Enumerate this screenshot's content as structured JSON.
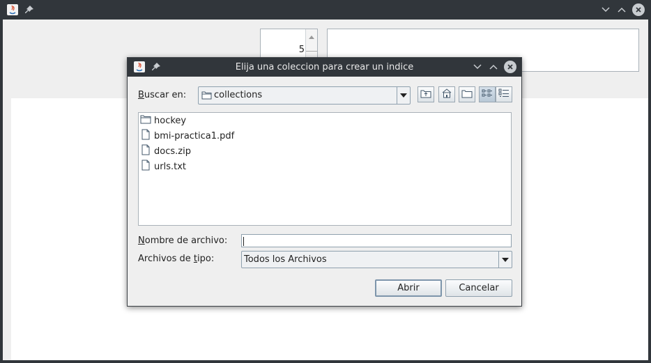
{
  "app": {
    "icons": [
      "java-icon",
      "pin-icon"
    ],
    "window_controls": [
      "minimize-icon",
      "maximize-icon",
      "close-icon"
    ],
    "spinner_value": "5"
  },
  "dialog": {
    "title": "Elija una coleccion para crear un indice",
    "look_in_label_mnemonic": "B",
    "look_in_label_rest": "uscar en:",
    "look_in_value": "collections",
    "toolbar_icons": [
      "up-folder-icon",
      "home-icon",
      "new-folder-icon",
      "list-view-icon",
      "details-view-icon"
    ],
    "files": [
      {
        "name": "hockey",
        "icon": "folder-icon"
      },
      {
        "name": "bmi-practica1.pdf",
        "icon": "file-icon"
      },
      {
        "name": "docs.zip",
        "icon": "file-icon"
      },
      {
        "name": "urls.txt",
        "icon": "file-icon"
      }
    ],
    "filename_label_mnemonic": "N",
    "filename_label_rest": "ombre de archivo:",
    "filename_value": "",
    "filetype_label_pre": "Archivos de ",
    "filetype_label_mnemonic": "t",
    "filetype_label_post": "ipo:",
    "filetype_value": "Todos los Archivos",
    "open_button": "Abrir",
    "cancel_button": "Cancelar"
  }
}
